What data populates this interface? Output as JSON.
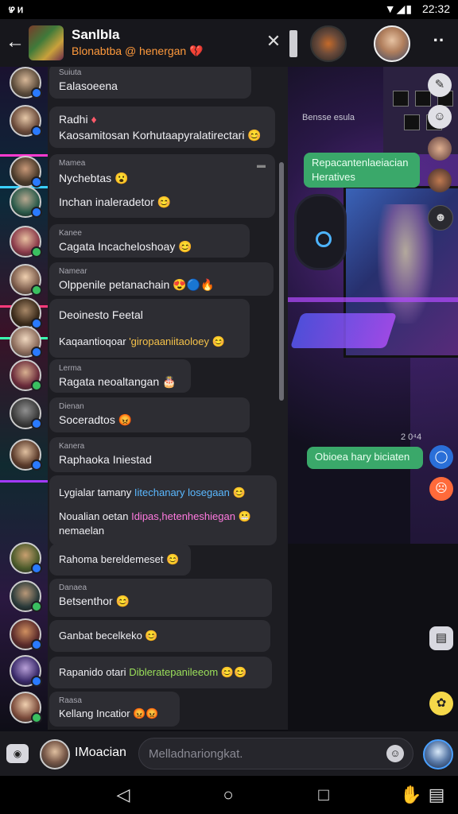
{
  "status_bar": {
    "left_text": "ഴ ᥢ",
    "time": "22:32",
    "signal": "▼◢▮"
  },
  "header": {
    "title": "Sanlbla",
    "subtitle": "Blonabtba @ henergan 💔",
    "back_icon": "arrow-left-icon",
    "close_icon": "close-icon",
    "more_icon": "more-vert-icon"
  },
  "messages": [
    {
      "name": "Suiuta",
      "text": "Ealasoeena"
    },
    {
      "name": "",
      "text": "Radhi",
      "text_suffix": "♦",
      "line2": "Kaosamitosan Korhutaapyralatirectari 😊",
      "line2_class": "g"
    },
    {
      "name": "Mamea",
      "text": "Nychebtas 😮",
      "line2": "Inchan inaleradetor 😊",
      "line2_class": "y"
    },
    {
      "name": "Kanee",
      "text": "Cagata Incacheloshoay 😊",
      "text_class": "y"
    },
    {
      "name": "Namear",
      "text": "Olppenile petanachain 😍🔵🔥",
      "text_class": "b"
    },
    {
      "name": "",
      "text": "Deoinesto Feetal",
      "line2": "Kaqaantioqoar",
      "line2_colored": "'giropaaniitaoloey 😊",
      "line2_colored_class": "y"
    },
    {
      "name": "Lerma",
      "text": "Ragata neoaltangan 🎂",
      "text_class": "y"
    },
    {
      "name": "Dienan",
      "text": "Soceradtos 😡"
    },
    {
      "name": "Kanera",
      "text": "Raphaoka Iniestad"
    },
    {
      "name": "",
      "text": "Lygialar tamany",
      "text_colored": "Iitechanary losegaan 😊",
      "text_colored_class": "b",
      "line2": "Noualian oetan",
      "line2_colored": "Idipas,hetenheshiegan 😬",
      "line2_colored_class": "p",
      "line3": "nemaelan",
      "line3_class": "p"
    },
    {
      "name": "",
      "text": "Rahoma bereldemeset 😊"
    },
    {
      "name": "Danaea",
      "text": "Betsenthor 😊"
    },
    {
      "name": "",
      "text": "Ganbat becelkeko 😊"
    },
    {
      "name": "",
      "text": "Rapanido otari",
      "text_colored": "Dibleratepanileeom 😊😊",
      "text_colored_class": "g"
    },
    {
      "name": "Raasa",
      "text": "Kellang Incatior 😡😡"
    }
  ],
  "right_panel": {
    "scene_label": "Bensse esula",
    "bubble_1": "Repacantenlaeiacian Heratives",
    "timestamp": "2 0⁴4",
    "bubble_2": "Obioea hary biciaten"
  },
  "composer": {
    "camera_icon": "camera-icon",
    "name": "IMoacian",
    "placeholder": "Melladnariongkat.",
    "emoji_icon": "emoji-icon"
  },
  "navbar": {
    "back_icon": "triangle-back-icon",
    "home_icon": "circle-home-icon",
    "recents_icon": "square-recents-icon",
    "extra_icons": [
      "hand-icon",
      "stack-icon"
    ]
  },
  "colors": {
    "accent_green": "#3aa86a",
    "subtitle_orange": "#ff9a3c",
    "link_blue": "#5ab8ff",
    "highlight_green": "#9be05a",
    "highlight_yellow": "#f5c24a",
    "highlight_pink": "#ff7adf"
  }
}
